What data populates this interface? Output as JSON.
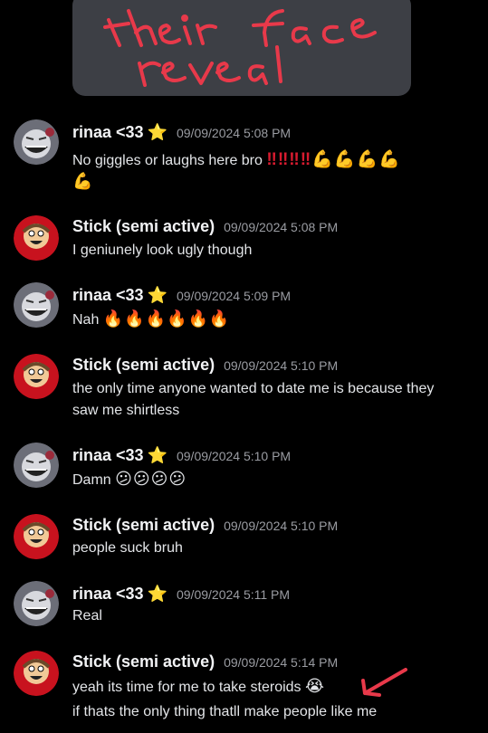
{
  "image_text": "their face reveal",
  "messages": [
    {
      "user": "rinaa <33",
      "badge": "⭐",
      "time": "09/09/2024 5:08 PM",
      "lines": [
        {
          "text": "No giggles or laughs here bro ",
          "suffix": "‼‼‼‼💪💪💪💪"
        },
        {
          "text": "",
          "suffix": "💪"
        }
      ]
    },
    {
      "user": "Stick (semi active)",
      "time": "09/09/2024 5:08 PM",
      "lines": [
        {
          "text": "I geniunely look ugly though"
        }
      ]
    },
    {
      "user": "rinaa <33",
      "badge": "⭐",
      "time": "09/09/2024 5:09 PM",
      "lines": [
        {
          "text": "Nah ",
          "suffix": "🔥🔥🔥🔥🔥🔥"
        }
      ]
    },
    {
      "user": "Stick (semi active)",
      "time": "09/09/2024 5:10 PM",
      "lines": [
        {
          "text": "the only time anyone wanted to date me is because they"
        },
        {
          "text": "saw me shirtless"
        }
      ]
    },
    {
      "user": "rinaa <33",
      "badge": "⭐",
      "time": "09/09/2024 5:10 PM",
      "lines": [
        {
          "text": "Damn ",
          "suffix": "😕😕😕😕"
        }
      ]
    },
    {
      "user": "Stick (semi active)",
      "time": "09/09/2024 5:10 PM",
      "lines": [
        {
          "text": "people suck bruh"
        }
      ]
    },
    {
      "user": "rinaa <33",
      "badge": "⭐",
      "time": "09/09/2024 5:11 PM",
      "lines": [
        {
          "text": "Real"
        }
      ]
    },
    {
      "user": "Stick (semi active)",
      "time": "09/09/2024 5:14 PM",
      "lines": [
        {
          "text": "yeah its time for me to take steroids ",
          "suffix": "😭"
        },
        {
          "text": "if thats the only thing thatll make people like me"
        }
      ]
    }
  ],
  "colors": {
    "background": "#000000",
    "accent_red": "#e8394a",
    "star": "#f7c325"
  },
  "icons": {
    "rinaa_avatar": "grinning-character-avatar",
    "stick_avatar": "cartoon-face-avatar",
    "annotation": "red-arrow"
  }
}
